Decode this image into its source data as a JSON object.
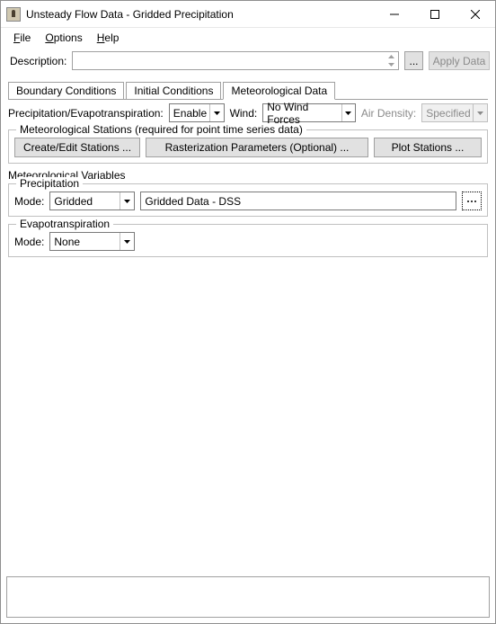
{
  "window": {
    "title": "Unsteady Flow Data - Gridded Precipitation"
  },
  "menu": {
    "file": "File",
    "options": "Options",
    "help": "Help"
  },
  "description": {
    "label": "Description:",
    "value": "",
    "ellipsis": "...",
    "apply": "Apply Data"
  },
  "tabs": {
    "boundary": "Boundary Conditions",
    "initial": "Initial Conditions",
    "meteo": "Meteorological Data"
  },
  "config": {
    "precip_evap_label": "Precipitation/Evapotranspiration:",
    "precip_evap_value": "Enable",
    "wind_label": "Wind:",
    "wind_value": "No Wind Forces",
    "air_density_label": "Air Density:",
    "air_density_value": "Specified"
  },
  "stations": {
    "legend": "Meteorological Stations (required for point time series data)",
    "create_edit": "Create/Edit Stations ...",
    "rasterization": "Rasterization Parameters (Optional) ...",
    "plot": "Plot Stations ..."
  },
  "variables": {
    "heading": "Meteorological Variables",
    "precip": {
      "legend": "Precipitation",
      "mode_label": "Mode:",
      "mode_value": "Gridded",
      "data_value": "Gridded Data - DSS"
    },
    "evap": {
      "legend": "Evapotranspiration",
      "mode_label": "Mode:",
      "mode_value": "None"
    }
  }
}
